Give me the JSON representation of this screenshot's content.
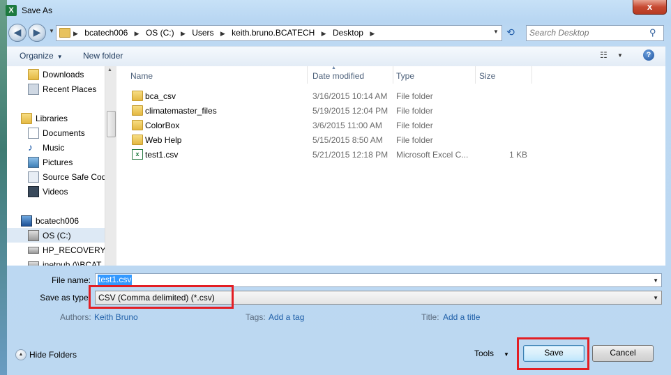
{
  "window": {
    "title": "Save As",
    "app_icon": "excel-icon",
    "close_label": "x"
  },
  "nav": {
    "back_icon": "back-arrow-icon",
    "forward_icon": "forward-arrow-icon",
    "breadcrumbs": [
      "bcatech006",
      "OS (C:)",
      "Users",
      "keith.bruno.BCATECH",
      "Desktop"
    ],
    "search_placeholder": "Search Desktop"
  },
  "toolbar": {
    "organize_label": "Organize",
    "new_folder_label": "New folder"
  },
  "sidebar": {
    "items": [
      {
        "label": "Downloads",
        "icon": "downloads-folder-icon",
        "indent": 1
      },
      {
        "label": "Recent Places",
        "icon": "recent-places-icon",
        "indent": 1
      },
      {
        "label": "Libraries",
        "icon": "libraries-icon",
        "indent": 0
      },
      {
        "label": "Documents",
        "icon": "documents-icon",
        "indent": 1
      },
      {
        "label": "Music",
        "icon": "music-icon",
        "indent": 1
      },
      {
        "label": "Pictures",
        "icon": "pictures-icon",
        "indent": 1
      },
      {
        "label": "Source Safe Code",
        "icon": "library-icon",
        "indent": 1
      },
      {
        "label": "Videos",
        "icon": "videos-icon",
        "indent": 1
      },
      {
        "label": "bcatech006",
        "icon": "computer-icon",
        "indent": 0
      },
      {
        "label": "OS (C:)",
        "icon": "drive-icon",
        "indent": 1,
        "selected": true
      },
      {
        "label": "HP_RECOVERY (D",
        "icon": "drive-icon",
        "indent": 1
      },
      {
        "label": "inetpub (\\\\BCAT",
        "icon": "network-drive-icon",
        "indent": 1
      }
    ]
  },
  "files": {
    "columns": [
      "Name",
      "Date modified",
      "Type",
      "Size"
    ],
    "rows": [
      {
        "name": "bca_csv",
        "date": "3/16/2015 10:14 AM",
        "type": "File folder",
        "size": "",
        "icon": "folder-icon"
      },
      {
        "name": "climatemaster_files",
        "date": "5/19/2015 12:04 PM",
        "type": "File folder",
        "size": "",
        "icon": "folder-icon"
      },
      {
        "name": "ColorBox",
        "date": "3/6/2015 11:00 AM",
        "type": "File folder",
        "size": "",
        "icon": "folder-icon"
      },
      {
        "name": "Web Help",
        "date": "5/15/2015 8:50 AM",
        "type": "File folder",
        "size": "",
        "icon": "folder-icon"
      },
      {
        "name": "test1.csv",
        "date": "5/21/2015 12:18 PM",
        "type": "Microsoft Excel C...",
        "size": "1 KB",
        "icon": "excel-csv-icon"
      }
    ]
  },
  "form": {
    "file_name_label": "File name:",
    "file_name_value": "test1.csv",
    "save_as_type_label": "Save as type:",
    "save_as_type_value": "CSV (Comma delimited) (*.csv)",
    "authors_label": "Authors:",
    "authors_value": "Keith Bruno",
    "tags_label": "Tags:",
    "tags_value": "Add a tag",
    "title_label": "Title:",
    "title_value": "Add a title"
  },
  "footer": {
    "hide_folders_label": "Hide Folders",
    "tools_label": "Tools",
    "save_label": "Save",
    "cancel_label": "Cancel"
  },
  "colors": {
    "highlight_box": "#e31e24",
    "selection": "#3399ff",
    "link": "#1f5fa8"
  }
}
